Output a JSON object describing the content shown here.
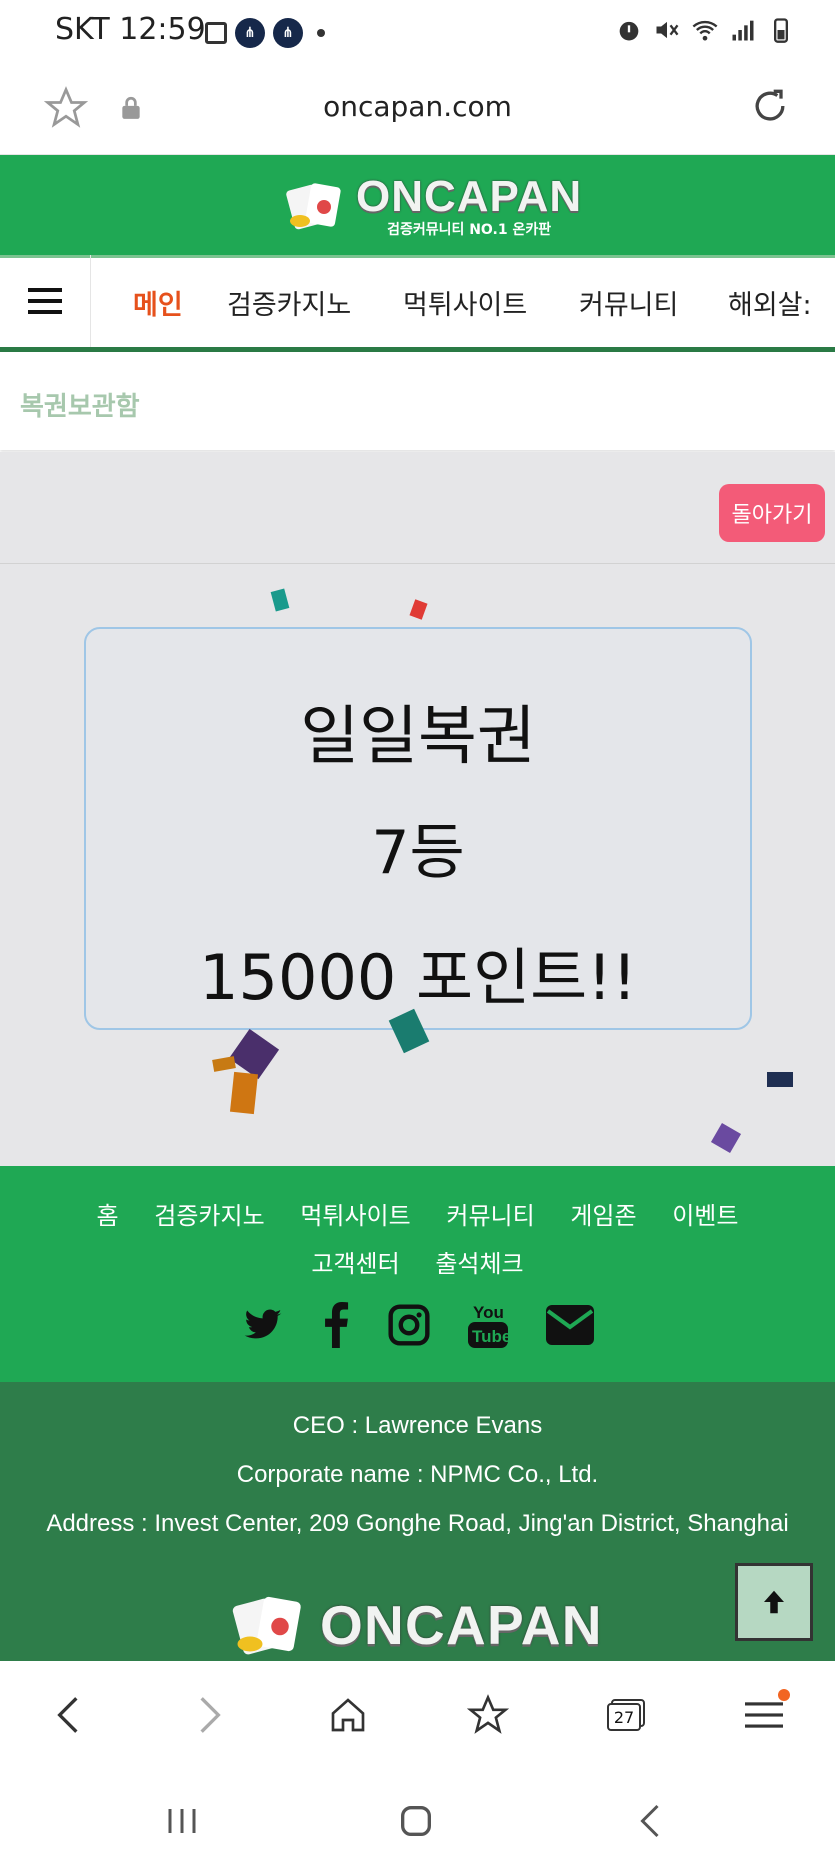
{
  "status_bar": {
    "carrier_time": "SKT 12:59",
    "icons": [
      "image-icon",
      "app-icon",
      "app-icon",
      "dot-icon",
      "alarm-icon",
      "mute-icon",
      "wifi-icon",
      "signal-icon",
      "battery-icon"
    ]
  },
  "url_bar": {
    "url": "oncapan.com"
  },
  "site": {
    "logo_text": "ONCAPAN",
    "logo_sub": "검증커뮤니티 NO.1 온카판",
    "brand_green": "#1fa854"
  },
  "nav": {
    "items": [
      {
        "label": "메인",
        "active": true
      },
      {
        "label": "검증카지노"
      },
      {
        "label": "먹튀사이트"
      },
      {
        "label": "커뮤니티"
      },
      {
        "label": "해외살:"
      }
    ]
  },
  "breadcrumb": {
    "label": "복권보관함"
  },
  "back_button": {
    "label": "돌아가기"
  },
  "prize": {
    "title": "일일복권",
    "rank": "7등",
    "points": "15000 포인트!!"
  },
  "footer": {
    "links_row1": [
      "홈",
      "검증카지노",
      "먹튀사이트",
      "커뮤니티",
      "게임존",
      "이벤트"
    ],
    "links_row2": [
      "고객센터",
      "출석체크"
    ],
    "social": [
      "twitter-icon",
      "facebook-icon",
      "instagram-icon",
      "youtube-icon",
      "mail-icon"
    ]
  },
  "info": {
    "ceo": "CEO : Lawrence Evans",
    "corp": "Corporate name : NPMC Co., Ltd.",
    "address": "Address : Invest Center, 209 Gonghe Road, Jing'an District, Shanghai"
  },
  "browser_bar": {
    "tabs_count": "27"
  }
}
